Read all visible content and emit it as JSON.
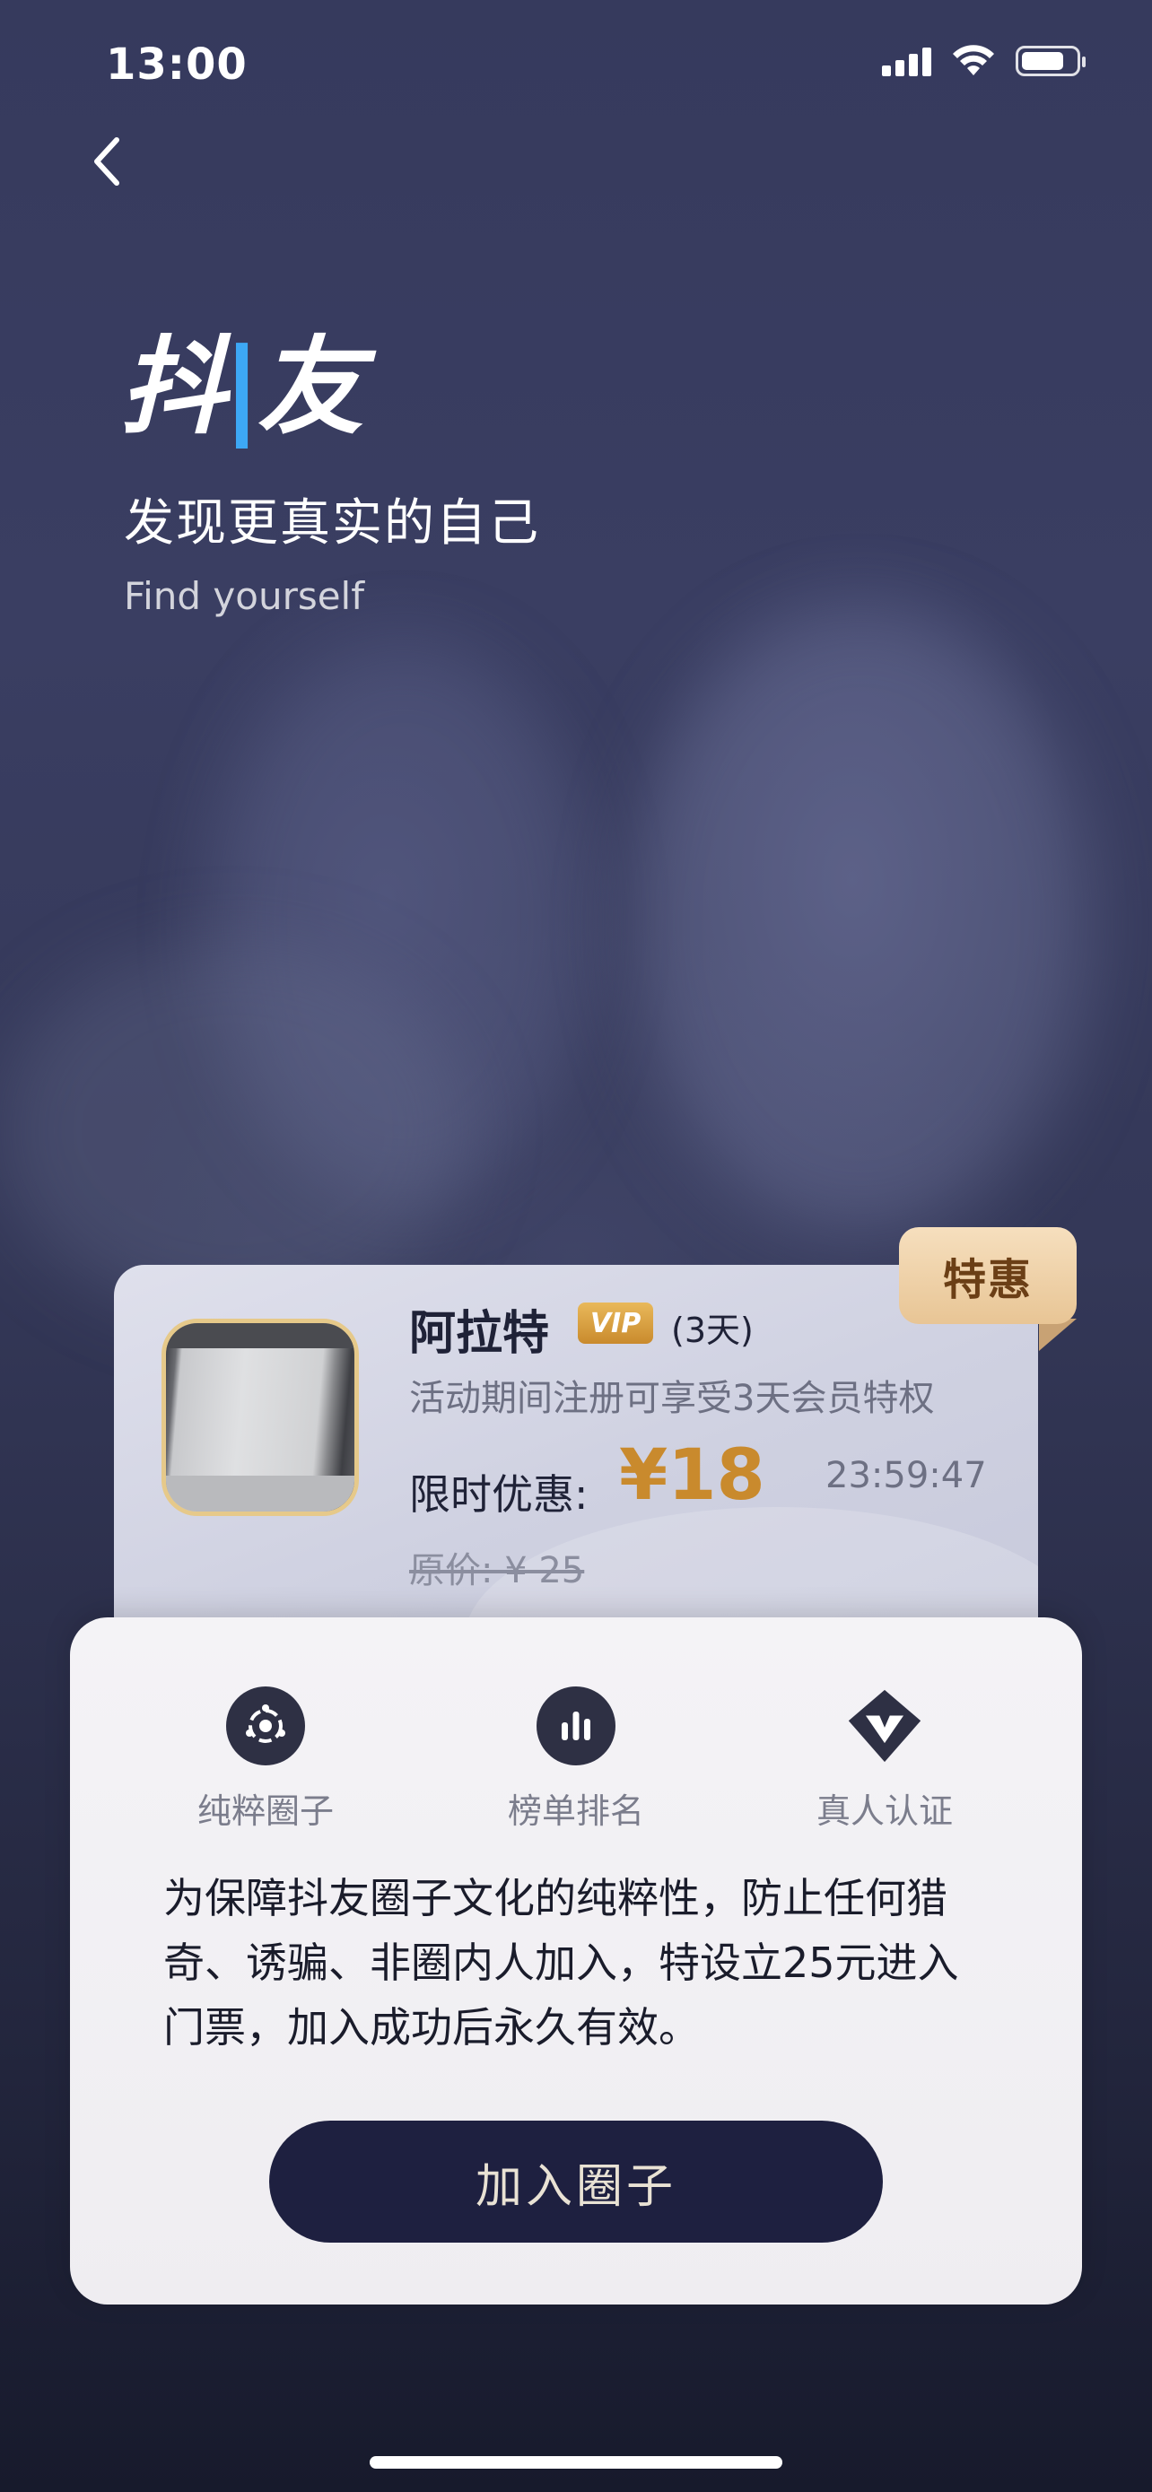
{
  "status_bar": {
    "time": "13:00"
  },
  "nav": {
    "back_icon": "chevron-left-icon"
  },
  "brand": {
    "logo_text_part1": "抖",
    "logo_text_accent": "|",
    "logo_text_part2": "友",
    "slogan_cn": "发现更真实的自己",
    "slogan_en": "Find yourself"
  },
  "promo": {
    "badge": "特惠",
    "user_name": "阿拉特",
    "vip_label": "VIP",
    "vip_days": "(3天)",
    "description": "活动期间注册可享受3天会员特权",
    "price_label": "限时优惠:",
    "price_value": "¥18",
    "countdown": "23:59:47",
    "original_price": "原价: ¥ 25"
  },
  "features": [
    {
      "icon": "circle-group-icon",
      "label": "纯粹圈子"
    },
    {
      "icon": "bar-chart-icon",
      "label": "榜单排名"
    },
    {
      "icon": "verified-v-icon",
      "label": "真人认证"
    }
  ],
  "sheet": {
    "description": "为保障抖友圈子文化的纯粹性，防止任何猎奇、诱骗、非圈内人加入，特设立25元进入门票，加入成功后永久有效。",
    "join_button": "加入圈子"
  },
  "colors": {
    "accent_gold": "#c98a2d",
    "button_dark": "#1e2040",
    "logo_accent": "#3da8f5"
  }
}
